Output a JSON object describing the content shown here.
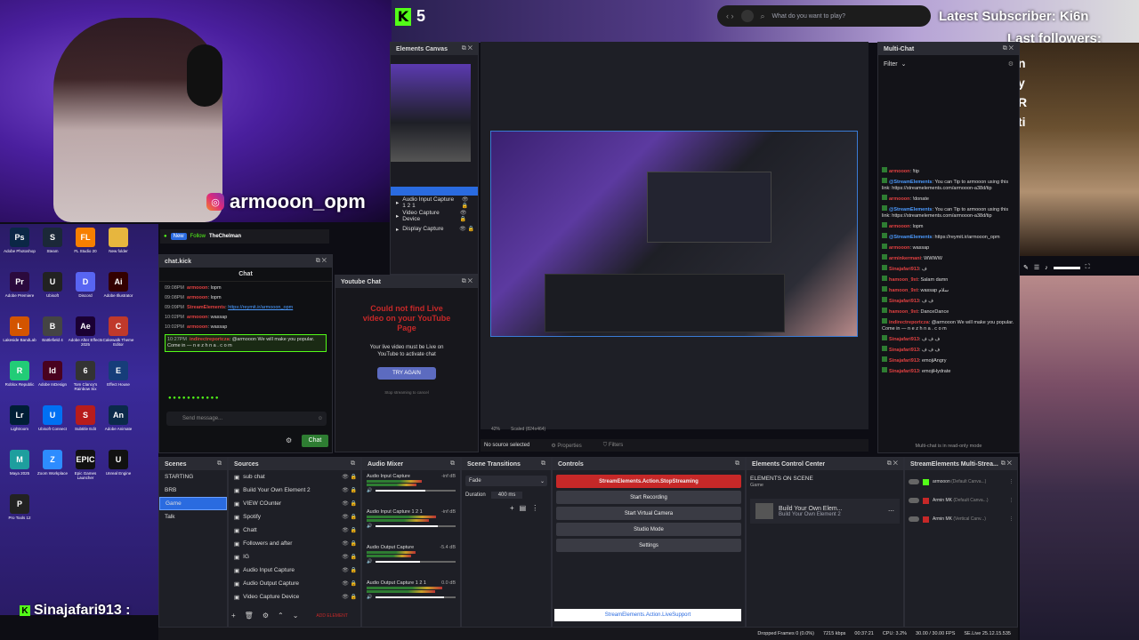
{
  "overlay": {
    "kick_count": "5",
    "instagram_handle": "armooon_opm",
    "latest_subscriber": "Latest Subscriber: Ki6n",
    "last_followers": "Last followers:",
    "follower_initials": [
      "n",
      "y",
      "R",
      "ti"
    ],
    "kick_user": "Sinajafari913 :",
    "search_placeholder": "What do you want to play?",
    "banner_user": "TheChelman",
    "banner_follow": "Follow",
    "banner_new": "New"
  },
  "desktop_icons": [
    {
      "label": "Adobe Photoshop",
      "abbr": "Ps",
      "color": "#0b2746"
    },
    {
      "label": "Steam",
      "abbr": "S",
      "color": "#1b2838"
    },
    {
      "label": "FL Studio 20",
      "abbr": "FL",
      "color": "#f77f00"
    },
    {
      "label": "New folder",
      "abbr": "",
      "color": "#e7b63e"
    },
    {
      "label": "Adobe Premiere",
      "abbr": "Pr",
      "color": "#2b0a3d"
    },
    {
      "label": "Ubisoft",
      "abbr": "U",
      "color": "#222"
    },
    {
      "label": "Discord",
      "abbr": "D",
      "color": "#5865f2"
    },
    {
      "label": "Adobe Illustrator",
      "abbr": "Ai",
      "color": "#330000"
    },
    {
      "label": "Lakeside BandLab",
      "abbr": "L",
      "color": "#d35400"
    },
    {
      "label": "Battlefield 4",
      "abbr": "B",
      "color": "#444"
    },
    {
      "label": "Adobe After Effects 2025",
      "abbr": "Ae",
      "color": "#1a0033"
    },
    {
      "label": "Cakewalk Theme Editor",
      "abbr": "C",
      "color": "#c0392b"
    },
    {
      "label": "Roblox Republic",
      "abbr": "R",
      "color": "#2c7"
    },
    {
      "label": "Adobe InDesign",
      "abbr": "Id",
      "color": "#49021f"
    },
    {
      "label": "Tom Clancy's Rainbow Six",
      "abbr": "6",
      "color": "#333"
    },
    {
      "label": "Effect House",
      "abbr": "E",
      "color": "#163d7a"
    },
    {
      "label": "Lightroom",
      "abbr": "Lr",
      "color": "#001e36"
    },
    {
      "label": "Ubisoft Connect",
      "abbr": "U",
      "color": "#0070f3"
    },
    {
      "label": "Subtitle Edit",
      "abbr": "S",
      "color": "#b71c1c"
    },
    {
      "label": "Adobe Animate",
      "abbr": "An",
      "color": "#0b2a4a"
    },
    {
      "label": "Maya 2025",
      "abbr": "M",
      "color": "#1e9e9e"
    },
    {
      "label": "Zoom Workplace",
      "abbr": "Z",
      "color": "#2d8cff"
    },
    {
      "label": "Epic Games Launcher",
      "abbr": "EPIC",
      "color": "#111"
    },
    {
      "label": "Unreal Engine",
      "abbr": "U",
      "color": "#111"
    },
    {
      "label": "Pro Tools 12",
      "abbr": "P",
      "color": "#222"
    }
  ],
  "kick_chat": {
    "panel_title": "chat.kick",
    "header": "Chat",
    "messages": [
      {
        "time": "09:08PM",
        "user": "armooon",
        "text": "lopm"
      },
      {
        "time": "09:08PM",
        "user": "armooon",
        "text": "lopm"
      },
      {
        "time": "09:09PM",
        "user": "StreamElements",
        "text": "https://reymit.ir/armooon_opm"
      },
      {
        "time": "10:02PM",
        "user": "armooon",
        "text": "wassap"
      },
      {
        "time": "10:02PM",
        "user": "armooon",
        "text": "wassap"
      },
      {
        "time": "10:27PM",
        "user": "indirectreportcza",
        "text": "@armooon We will make you popular. Come in — n e z h n a . c o m"
      }
    ],
    "input_placeholder": "Send message...",
    "send_label": "Chat"
  },
  "canvas_panel": {
    "title": "Elements Canvas"
  },
  "youtube_chat": {
    "title": "Youtube Chat",
    "error": "Could not find Live video on your YouTube Page",
    "info": "Your live video must be Live on YouTube to activate chat",
    "button": "TRY AGAIN",
    "footer": "Stop streaming to cancel"
  },
  "scene_sources_mini": [
    "Audio Input Capture 1 2 1",
    "Video Capture Device",
    "Display Capture"
  ],
  "preview": {
    "status": "No source selected",
    "properties": "Properties",
    "filters": "Filters",
    "zoom": "42%",
    "scale": "Scaled (824x464)"
  },
  "multichat": {
    "title": "Multi-Chat",
    "filter": "Filter",
    "footer": "Multi-chat is in read-only mode",
    "messages": [
      {
        "user": "armooon",
        "text": "!tip"
      },
      {
        "user": "@StreamElements",
        "text": "You can Tip to armooon using this link: https://streamelements.com/armooon-a38d/tip"
      },
      {
        "user": "armooon",
        "text": "!donate"
      },
      {
        "user": "@StreamElements",
        "text": "You can Tip to armooon using this link: https://streamelements.com/armooon-a38d/tip"
      },
      {
        "user": "armooon",
        "text": "lopm"
      },
      {
        "user": "@StreamElements",
        "text": "https://reymit.ir/armooon_opm"
      },
      {
        "user": "armooon",
        "text": "wassap"
      },
      {
        "user": "arminkermani",
        "text": "WWWW"
      },
      {
        "user": "Sinajafari913",
        "text": "ف"
      },
      {
        "user": "hamoon_9xt",
        "text": "Salam damn"
      },
      {
        "user": "hamoon_9xt",
        "text": "wassap سلام"
      },
      {
        "user": "Sinajafari913",
        "text": "ف ف"
      },
      {
        "user": "hamoon_9xt",
        "text": "DanceDance"
      },
      {
        "user": "indirectreportcza",
        "text": "@armooon We will make you popular. Come in — n e z h n a . c o m"
      },
      {
        "user": "Sinajafari913",
        "text": "ف ف ف"
      },
      {
        "user": "Sinajafari913",
        "text": "ف ف ف"
      },
      {
        "user": "Sinajafari913",
        "text": "emojiAngry"
      },
      {
        "user": "Sinajafari913",
        "text": "emojiHydrate"
      }
    ]
  },
  "scenes": {
    "title": "Scenes",
    "items": [
      "STARTING",
      "BRB",
      "Game",
      "Talk"
    ],
    "selected": "Game"
  },
  "sources": {
    "title": "Sources",
    "items": [
      "sub chat",
      "Build Your Own Element 2",
      "VIEW COunter",
      "Spotify",
      "Chatt",
      "Followers and after",
      "IG",
      "Audio Input Capture",
      "Audio Output Capture",
      "Video Capture Device"
    ]
  },
  "mixer": {
    "title": "Audio Mixer",
    "channels": [
      {
        "name": "Audio Input Capture",
        "db": "-inf dB",
        "level": 0.62
      },
      {
        "name": "Audio Input Capture 1 2 1",
        "db": "-inf dB",
        "level": 0.78
      },
      {
        "name": "Audio Output Capture",
        "db": "-5.4 dB",
        "level": 0.55
      },
      {
        "name": "Audio Output Capture 1 2 1",
        "db": "0.0 dB",
        "level": 0.85
      }
    ]
  },
  "transitions": {
    "title": "Scene Transitions",
    "type": "Fade",
    "duration_label": "Duration",
    "duration": "400 ms"
  },
  "controls": {
    "title": "Controls",
    "stop": "StreamElements.Action.StopStreaming",
    "start_recording": "Start Recording",
    "virtual_cam": "Start Virtual Camera",
    "studio_mode": "Studio Mode",
    "settings": "Settings",
    "support": "StreamElements.Action.LiveSupport"
  },
  "elements_control": {
    "title": "Elements Control Center",
    "heading": "ELEMENTS ON SCENE",
    "scene": "Game",
    "item_name": "Build Your Own Elem...",
    "item_sub": "Build Your Own Element 2"
  },
  "multistream": {
    "title": "StreamElements Multi-Strea...",
    "targets": [
      {
        "user": "armooon",
        "label": "Default Canva..."
      },
      {
        "user": "Armin MK",
        "label": "Default Canva..."
      },
      {
        "user": "Armin MK",
        "label": "Vertical Canv..."
      }
    ]
  },
  "statusbar": {
    "dropped": "Dropped Frames 0 (0.0%)",
    "bitrate": "7215 kbps",
    "time": "00:37:21",
    "cpu": "CPU: 3.2%",
    "fps": "30.00 / 30.00 FPS",
    "se": "SE.Live 25.12.15.535"
  },
  "add_element": "ADD ELEMENT",
  "colors": {
    "accent_blue": "#2a6be0",
    "stop_red": "#c62828",
    "kick_green": "#53fc18",
    "purple_bg": "#6a2bd8"
  }
}
